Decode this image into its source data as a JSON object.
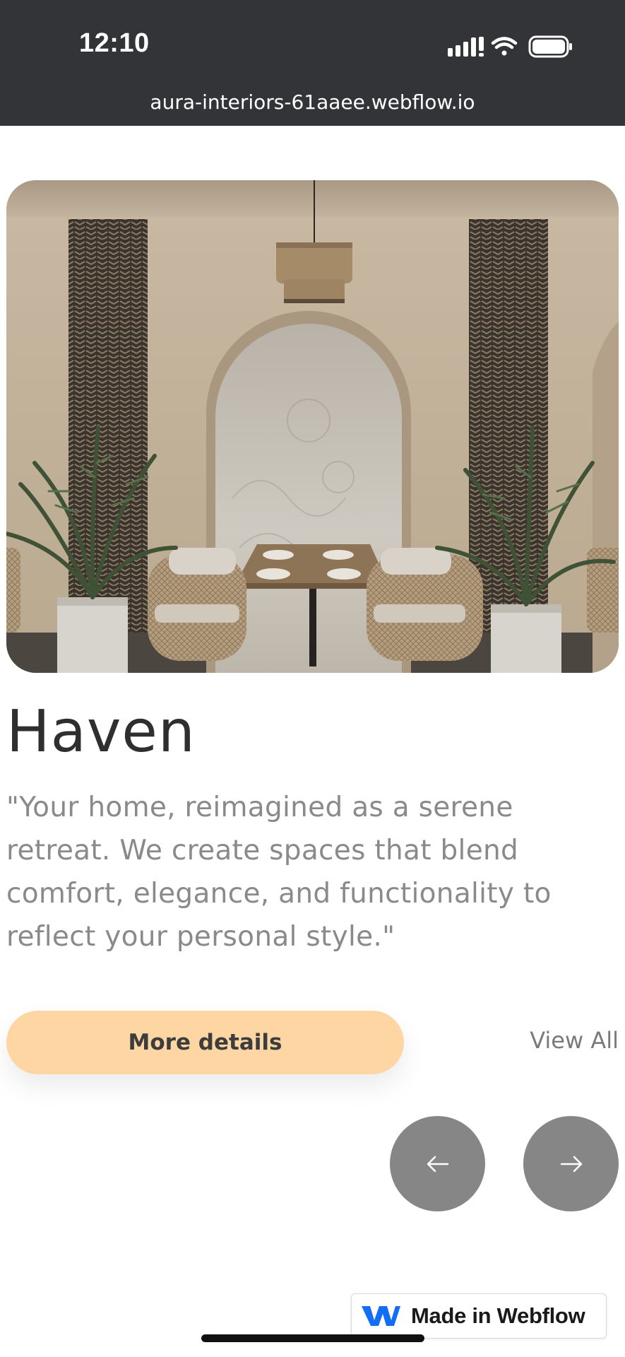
{
  "status_bar": {
    "time": "12:10",
    "icons": [
      "signal-icon",
      "wifi-icon",
      "battery-icon"
    ]
  },
  "browser": {
    "url": "aura-interiors-61aaee.webflow.io"
  },
  "hero": {
    "image": "dining-room-photo"
  },
  "content": {
    "title": "Haven",
    "quote": "\"Your home, reimagined as a serene retreat. We create spaces that blend comfort, elegance, and functionality to reflect your personal style.\""
  },
  "actions": {
    "more_details": "More details",
    "view_all": "View All",
    "prev_icon": "arrow-left-icon",
    "next_icon": "arrow-right-icon"
  },
  "badge": {
    "label": "Made in Webflow",
    "icon": "webflow-logo-icon"
  },
  "colors": {
    "topbar": "#323437",
    "primary_button": "#fdd6a4",
    "nav_button": "#868686",
    "title_text": "#2f2f2f",
    "body_text": "#8a8a8a",
    "webflow_blue": "#146ef5"
  }
}
